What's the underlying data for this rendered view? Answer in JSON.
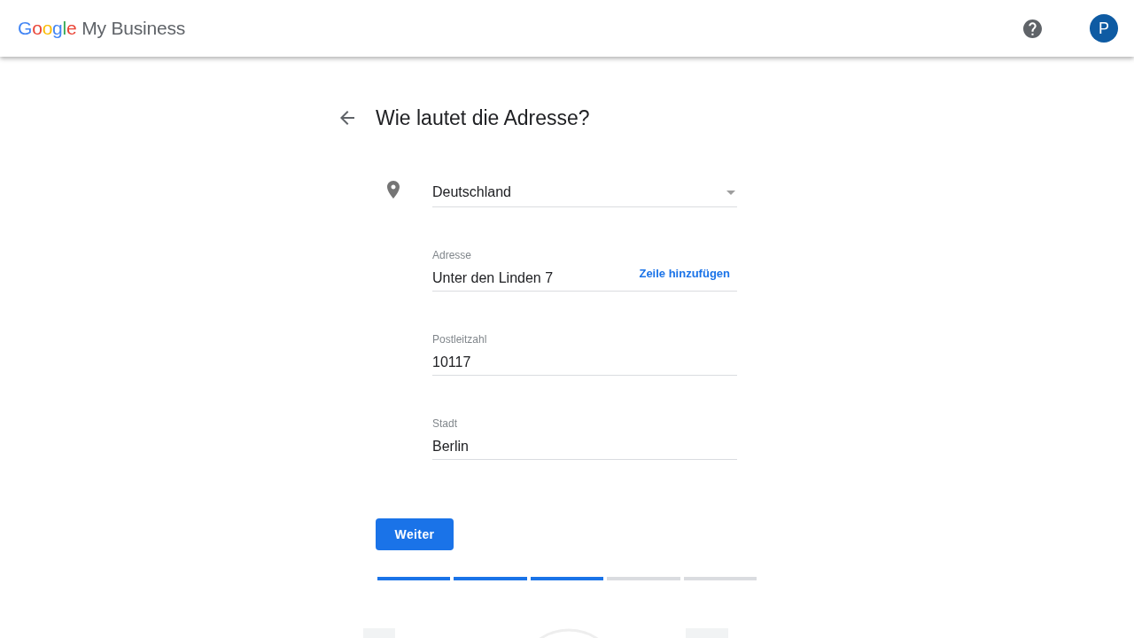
{
  "header": {
    "logo": {
      "brand": "Google",
      "product": "My Business"
    },
    "avatar": {
      "letter": "P"
    }
  },
  "page": {
    "title": "Wie lautet die Adresse?"
  },
  "form": {
    "country": {
      "value": "Deutschland"
    },
    "fields": [
      {
        "label": "Adresse",
        "value": "Unter den Linden 7",
        "action": "Zeile hinzufügen"
      },
      {
        "label": "Postleitzahl",
        "value": "10117"
      },
      {
        "label": "Stadt",
        "value": "Berlin"
      }
    ]
  },
  "next_button": "Weiter",
  "progress": {
    "steps": [
      {
        "completed": true
      },
      {
        "completed": true
      },
      {
        "completed": true
      },
      {
        "completed": false
      },
      {
        "completed": false
      }
    ]
  }
}
